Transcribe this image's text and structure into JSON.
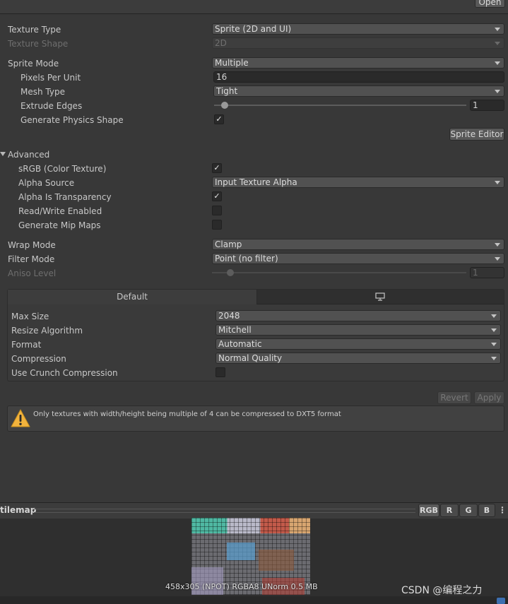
{
  "toolbar": {
    "open_label": "Open"
  },
  "texture": {
    "type_label": "Texture Type",
    "type_value": "Sprite (2D and UI)",
    "shape_label": "Texture Shape",
    "shape_value": "2D",
    "sprite_mode_label": "Sprite Mode",
    "sprite_mode_value": "Multiple",
    "ppu_label": "Pixels Per Unit",
    "ppu_value": "16",
    "mesh_label": "Mesh Type",
    "mesh_value": "Tight",
    "extrude_label": "Extrude Edges",
    "extrude_value": "1",
    "physics_label": "Generate Physics Shape",
    "physics_checked": true,
    "sprite_editor_label": "Sprite Editor"
  },
  "advanced": {
    "header": "Advanced",
    "srgb_label": "sRGB (Color Texture)",
    "srgb_checked": true,
    "alpha_source_label": "Alpha Source",
    "alpha_source_value": "Input Texture Alpha",
    "alpha_transp_label": "Alpha Is Transparency",
    "alpha_transp_checked": true,
    "rw_label": "Read/Write Enabled",
    "rw_checked": false,
    "mip_label": "Generate Mip Maps",
    "mip_checked": false
  },
  "sampling": {
    "wrap_label": "Wrap Mode",
    "wrap_value": "Clamp",
    "filter_label": "Filter Mode",
    "filter_value": "Point (no filter)",
    "aniso_label": "Aniso Level",
    "aniso_value": "1"
  },
  "platform": {
    "tab_default": "Default",
    "tab_icon": "monitor-icon",
    "max_size_label": "Max Size",
    "max_size_value": "2048",
    "resize_label": "Resize Algorithm",
    "resize_value": "Mitchell",
    "format_label": "Format",
    "format_value": "Automatic",
    "compression_label": "Compression",
    "compression_value": "Normal Quality",
    "crunch_label": "Use Crunch Compression",
    "crunch_checked": false
  },
  "actions": {
    "revert_label": "Revert",
    "apply_label": "Apply"
  },
  "warning": {
    "icon": "warning-icon",
    "text": "Only textures with width/height being multiple of 4 can be compressed to DXT5 format"
  },
  "preview": {
    "title": "tilemap",
    "channels": [
      "RGB",
      "R",
      "G",
      "B"
    ],
    "info": "458x305 (NPOT) RGBA8 UNorm 0.5 MB"
  },
  "watermark": "CSDN @编程之力",
  "colors": {
    "panel": "#383838",
    "warning_yellow": "#f2b33d"
  }
}
